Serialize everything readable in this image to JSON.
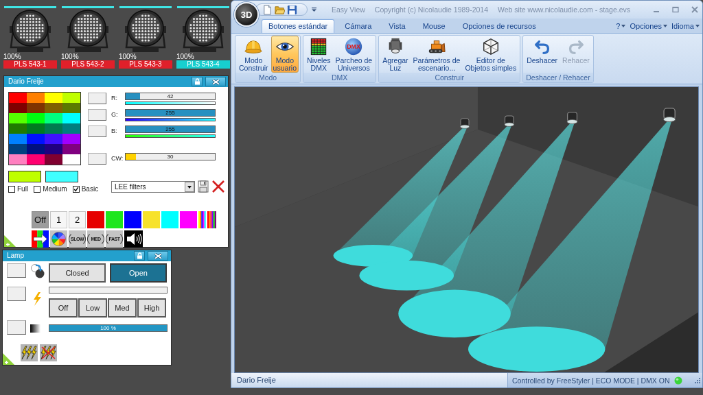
{
  "fixtures": [
    {
      "label": "PLS 543-1",
      "intensity": "100%",
      "selected": false
    },
    {
      "label": "PLS 543-2",
      "intensity": "100%",
      "selected": false
    },
    {
      "label": "PLS 543-3",
      "intensity": "100%",
      "selected": false
    },
    {
      "label": "PLS 543-4",
      "intensity": "100%",
      "selected": true
    }
  ],
  "color_panel": {
    "title": "Dario Freije",
    "palette": [
      {
        "color": "#ff0000"
      },
      {
        "color": "#ff8000"
      },
      {
        "color": "#ffff00"
      },
      {
        "color": "#bfff00"
      },
      {
        "color": "#800000"
      },
      {
        "color": "#803300"
      },
      {
        "color": "#806000"
      },
      {
        "color": "#5a7a00"
      },
      {
        "color": "#55ff00"
      },
      {
        "color": "#00ff10"
      },
      {
        "color": "#00ff80"
      },
      {
        "color": "#00ffff"
      },
      {
        "color": "#207a00"
      },
      {
        "color": "#007a20"
      },
      {
        "color": "#007a50"
      },
      {
        "color": "#007f80"
      },
      {
        "color": "#0080ff"
      },
      {
        "color": "#0010ff"
      },
      {
        "color": "#4010ff"
      },
      {
        "color": "#a000ff"
      },
      {
        "color": "#004080"
      },
      {
        "color": "#001080"
      },
      {
        "color": "#200080"
      },
      {
        "color": "#800080"
      },
      {
        "color": "#ff80c0"
      },
      {
        "color": "#ff0070"
      },
      {
        "color": "#800030"
      },
      {
        "color": "#ffffff"
      }
    ],
    "current_colors": [
      {
        "color": "#bfff00"
      },
      {
        "color": "#40ffff"
      }
    ],
    "palette_modes": [
      {
        "label": "Full",
        "checked": false
      },
      {
        "label": "Medium",
        "checked": false
      },
      {
        "label": "Basic",
        "checked": true
      }
    ],
    "channels": [
      {
        "kind": "rgb",
        "label": "R:",
        "value": "42",
        "level": 0.165
      },
      {
        "kind": "rgb",
        "label": "G:",
        "value": "255",
        "level": 1
      },
      {
        "kind": "rgb",
        "label": "B:",
        "value": "255",
        "level": 1
      },
      {
        "kind": "white",
        "label": "CW:",
        "value": "30",
        "level": 0.118
      }
    ],
    "filter_select": {
      "value": "LEE filters"
    },
    "macros": [
      {
        "kind": "text",
        "label": "Off",
        "selected": true
      },
      {
        "kind": "text",
        "label": "1",
        "selected": false
      },
      {
        "kind": "text",
        "label": "2",
        "selected": false
      },
      {
        "kind": "color",
        "color": "#e60000",
        "selected": false
      },
      {
        "kind": "color",
        "color": "#1ee61e",
        "selected": false
      },
      {
        "kind": "color",
        "color": "#0000ff",
        "selected": false
      },
      {
        "kind": "color",
        "color": "#f7e22c",
        "selected": false
      },
      {
        "kind": "color",
        "color": "#00ffff",
        "selected": false
      },
      {
        "kind": "color",
        "color": "#ff00ff",
        "selected": false
      },
      {
        "kind": "rainbow",
        "selected": false
      }
    ],
    "effects": [
      {
        "kind": "rgb-arrow"
      },
      {
        "kind": "wheel"
      },
      {
        "kind": "speed",
        "label": "SLOW"
      },
      {
        "kind": "speed",
        "label": "MED"
      },
      {
        "kind": "speed",
        "label": "FAST"
      },
      {
        "kind": "sound"
      }
    ]
  },
  "lamp_panel": {
    "title": "Lamp",
    "shutter": [
      {
        "label": "Closed",
        "selected": false
      },
      {
        "label": "Open",
        "selected": true
      }
    ],
    "power": {
      "options": [
        {
          "label": "Off",
          "selected": false
        },
        {
          "label": "Low",
          "selected": false
        },
        {
          "label": "Med",
          "selected": false
        },
        {
          "label": "High",
          "selected": false
        }
      ]
    },
    "dimmer": {
      "level": 1,
      "reading": "100 %"
    }
  },
  "app": {
    "menu_button": "3D",
    "title_parts": [
      "Easy View",
      "Copyright (c) Nicolaudie 1989-2014",
      "Web site www.nicolaudie.com - stage.evs"
    ],
    "tabs": [
      {
        "label": "Botones estándar",
        "selected": true
      },
      {
        "label": "Cámara",
        "selected": false
      },
      {
        "label": "Vista",
        "selected": false
      },
      {
        "label": "Mouse",
        "selected": false
      },
      {
        "label": "Opciones de recursos",
        "selected": false
      }
    ],
    "menus": [
      "?",
      "Opciones",
      "Idioma"
    ],
    "ribbon_groups": [
      {
        "title": "Modo",
        "buttons": [
          {
            "kind": "helmet",
            "label": "Modo\nConstruir",
            "selected": false,
            "disabled": false
          },
          {
            "kind": "eye",
            "label": "Modo\nusuario",
            "selected": true,
            "disabled": false
          }
        ]
      },
      {
        "title": "DMX",
        "buttons": [
          {
            "kind": "meter",
            "label": "Niveles\nDMX",
            "selected": false,
            "disabled": false
          },
          {
            "kind": "globe",
            "badge": "DMX",
            "label": "Parcheo de\nUniversos",
            "selected": false,
            "disabled": false
          }
        ]
      },
      {
        "title": "Construir",
        "buttons": [
          {
            "kind": "spot",
            "label": "Agregar\nLuz",
            "selected": false,
            "disabled": false
          },
          {
            "kind": "bulldozer",
            "label": "Parámetros de\nescenario...",
            "selected": false,
            "disabled": false
          },
          {
            "kind": "cube",
            "label": "Editor de\nObjetos simples",
            "selected": false,
            "disabled": false
          }
        ]
      },
      {
        "title": "Deshacer / Rehacer",
        "buttons": [
          {
            "kind": "undo",
            "label": "Deshacer",
            "selected": false,
            "disabled": false
          },
          {
            "kind": "redo",
            "label": "Rehacer",
            "selected": false,
            "disabled": true
          }
        ]
      }
    ]
  },
  "status_bar": {
    "left": "Dario Freije",
    "right": "Controlled by FreeStyler | ECO MODE | DMX ON",
    "dmx_led_on": true
  }
}
